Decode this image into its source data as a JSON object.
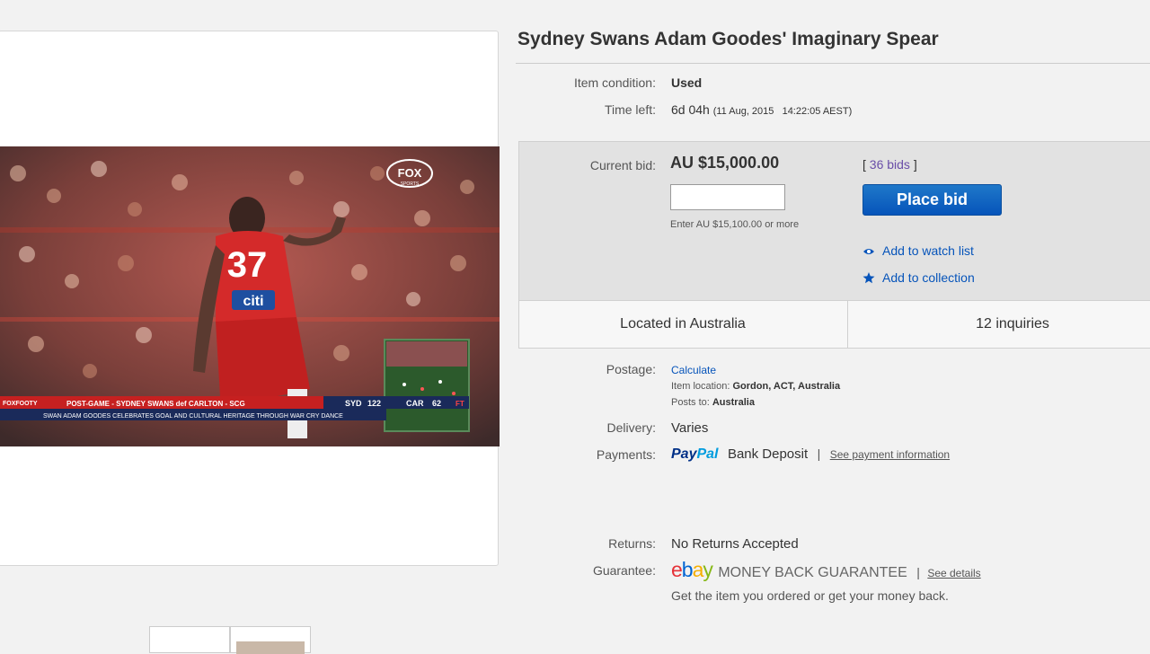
{
  "item": {
    "title": "Sydney Swans Adam Goodes' Imaginary Spear",
    "condition_label": "Item condition:",
    "condition_value": "Used",
    "time_left_label": "Time left:",
    "time_left_value": "6d 04h",
    "time_left_end": "(11 Aug, 2015   14:22:05 AEST)"
  },
  "bid": {
    "current_bid_label": "Current bid:",
    "current_bid_value": "AU $15,000.00",
    "bids_prefix": "[",
    "bids_link": "36 bids",
    "bids_suffix": "]",
    "input_value": "",
    "input_hint": "Enter AU $15,100.00 or more",
    "place_bid_label": "Place bid",
    "watch_list_label": "Add to watch list",
    "collection_label": "Add to collection",
    "location": "Located in Australia",
    "inquiries": "12 inquiries"
  },
  "shipping": {
    "postage_label": "Postage:",
    "postage_link": "Calculate",
    "item_location_label": "Item location:",
    "item_location_value": "Gordon, ACT, Australia",
    "posts_to_label": "Posts to:",
    "posts_to_value": "Australia",
    "delivery_label": "Delivery:",
    "delivery_value": "Varies",
    "payments_label": "Payments:",
    "paypal_pay": "Pay",
    "paypal_pal": "Pal",
    "bank_deposit": "Bank Deposit",
    "payments_separator": "|",
    "payment_info_link": "See payment information",
    "returns_label": "Returns:",
    "returns_value": "No Returns Accepted",
    "guarantee_label": "Guarantee:",
    "ebay_letters": [
      "e",
      "b",
      "a",
      "y"
    ],
    "money_back": "MONEY BACK GUARANTEE",
    "guarantee_separator": "|",
    "see_details_link": "See details",
    "guarantee_note": "Get the item you ordered or get your money back."
  },
  "photo": {
    "player_number": "37",
    "sponsor": "citi",
    "broadcaster_logo": "FOX",
    "broadcaster_sub": "SPORTS",
    "channel": "FOXFOOTY",
    "banner_line1": "POST-GAME - SYDNEY SWANS def CARLTON - SCG",
    "banner_line2": "SWAN ADAM GOODES CELEBRATES GOAL AND CULTURAL HERITAGE THROUGH WAR CRY DANCE",
    "team1": "SYD",
    "score1": "122",
    "team2": "CAR",
    "score2": "62",
    "status": "FT"
  },
  "colors": {
    "ebay_letters": [
      "#e53238",
      "#0064d2",
      "#f5af02",
      "#86b817"
    ],
    "link": "#0654ba",
    "paypal_dark": "#003087",
    "paypal_light": "#009cde",
    "place_bid_bg": "#0654ba"
  },
  "icons": {
    "watch_list": "eye-icon",
    "collection": "star-icon"
  }
}
